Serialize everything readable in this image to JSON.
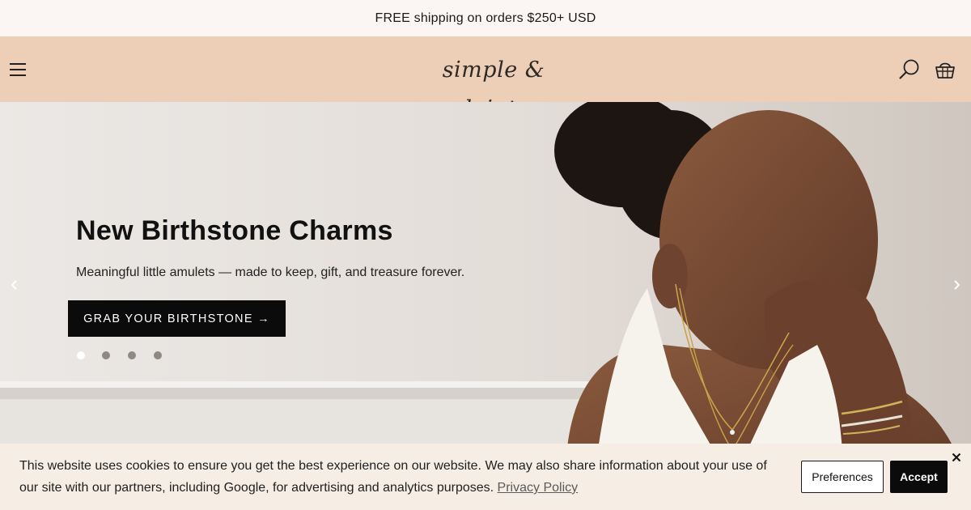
{
  "announcement": {
    "text": "FREE shipping on orders $250+ USD"
  },
  "header": {
    "logo_text": "simple & dainty",
    "menu_icon": "hamburger-menu-icon",
    "search_icon": "search-icon",
    "cart_icon": "shopping-basket-icon",
    "background_color": "#eccfb6"
  },
  "hero": {
    "title": "New Birthstone Charms",
    "subtitle": "Meaningful little amulets — made to keep, gift, and treasure forever.",
    "cta_label": "GRAB YOUR BIRTHSTONE →",
    "slides_count": 4,
    "active_slide": 1,
    "prev_icon": "chevron-left-icon",
    "next_icon": "chevron-right-icon"
  },
  "cookie_banner": {
    "text": "This website uses cookies to ensure you get the best experience on our website. We may also share information about your use of our site with our partners, including Google, for advertising and analytics purposes.",
    "privacy_link": "Privacy Policy",
    "preferences_label": "Preferences",
    "accept_label": "Accept",
    "close_icon": "close-icon",
    "background_color": "#f6ede4"
  }
}
